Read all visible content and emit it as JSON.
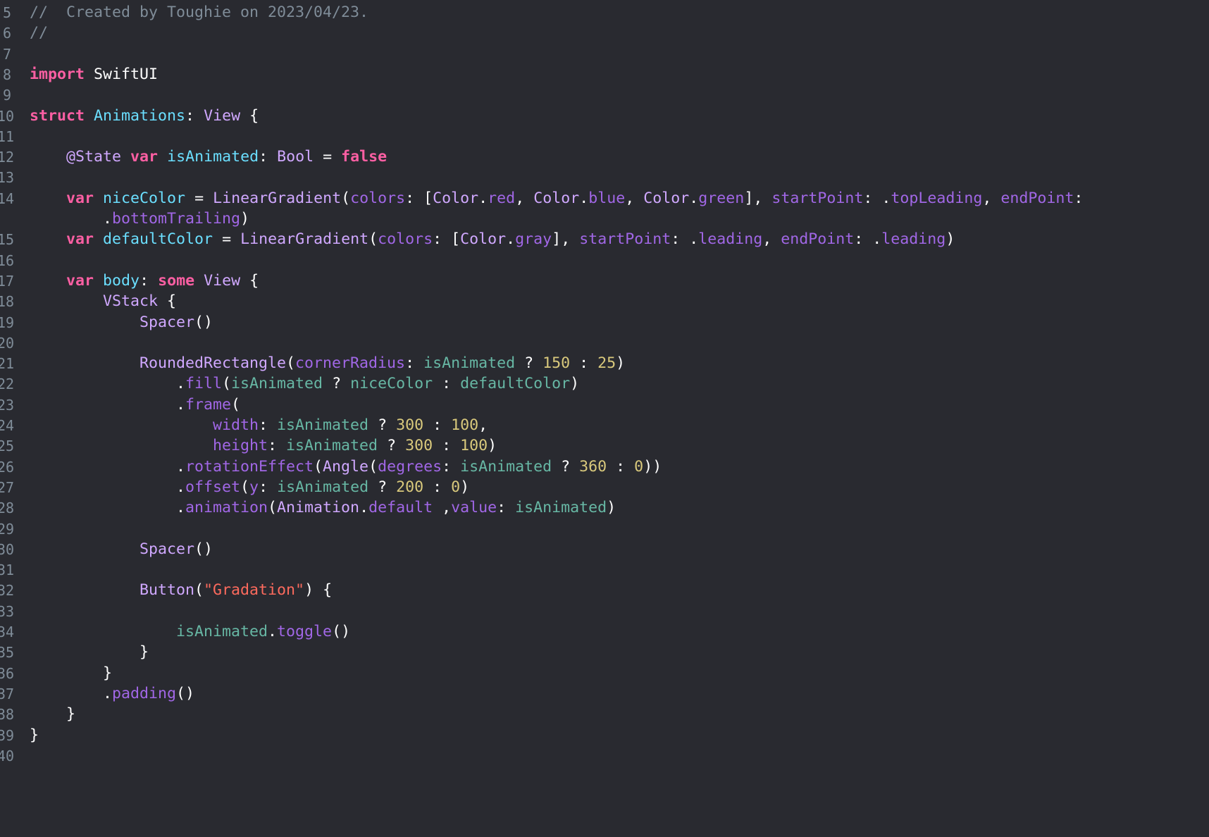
{
  "editor": {
    "theme_background": "#292a30",
    "line_numbers": [
      "5",
      "6",
      "7",
      "8",
      "9",
      "10",
      "11",
      "12",
      "13",
      "14",
      "15",
      "16",
      "17",
      "18",
      "19",
      "20",
      "21",
      "22",
      "23",
      "24",
      "25",
      "26",
      "27",
      "28",
      "29",
      "30",
      "31",
      "32",
      "33",
      "34",
      "35",
      "36",
      "37",
      "38",
      "39",
      "40"
    ],
    "lines": [
      {
        "tokens": [
          {
            "c": "comment",
            "t": "//  Created by Toughie on 2023/04/23."
          }
        ]
      },
      {
        "tokens": [
          {
            "c": "comment",
            "t": "//"
          }
        ]
      },
      {
        "tokens": []
      },
      {
        "tokens": [
          {
            "c": "kw",
            "t": "import"
          },
          {
            "c": "t",
            "t": " SwiftUI"
          }
        ]
      },
      {
        "tokens": []
      },
      {
        "tokens": [
          {
            "c": "kw",
            "t": "struct"
          },
          {
            "c": "t",
            "t": " "
          },
          {
            "c": "decl",
            "t": "Animations"
          },
          {
            "c": "t",
            "t": ": "
          },
          {
            "c": "type",
            "t": "View"
          },
          {
            "c": "t",
            "t": " {"
          }
        ]
      },
      {
        "tokens": []
      },
      {
        "tokens": [
          {
            "c": "t",
            "t": "    "
          },
          {
            "c": "attr",
            "t": "@State"
          },
          {
            "c": "t",
            "t": " "
          },
          {
            "c": "kw",
            "t": "var"
          },
          {
            "c": "t",
            "t": " "
          },
          {
            "c": "decl",
            "t": "isAnimated"
          },
          {
            "c": "t",
            "t": ": "
          },
          {
            "c": "type",
            "t": "Bool"
          },
          {
            "c": "t",
            "t": " = "
          },
          {
            "c": "kw",
            "t": "false"
          }
        ]
      },
      {
        "tokens": []
      },
      {
        "tokens": [
          {
            "c": "t",
            "t": "    "
          },
          {
            "c": "kw",
            "t": "var"
          },
          {
            "c": "t",
            "t": " "
          },
          {
            "c": "decl",
            "t": "niceColor"
          },
          {
            "c": "t",
            "t": " = "
          },
          {
            "c": "type",
            "t": "LinearGradient"
          },
          {
            "c": "t",
            "t": "("
          },
          {
            "c": "param",
            "t": "colors"
          },
          {
            "c": "t",
            "t": ": ["
          },
          {
            "c": "type",
            "t": "Color"
          },
          {
            "c": "t",
            "t": "."
          },
          {
            "c": "mem",
            "t": "red"
          },
          {
            "c": "t",
            "t": ", "
          },
          {
            "c": "type",
            "t": "Color"
          },
          {
            "c": "t",
            "t": "."
          },
          {
            "c": "mem",
            "t": "blue"
          },
          {
            "c": "t",
            "t": ", "
          },
          {
            "c": "type",
            "t": "Color"
          },
          {
            "c": "t",
            "t": "."
          },
          {
            "c": "mem",
            "t": "green"
          },
          {
            "c": "t",
            "t": "], "
          },
          {
            "c": "param",
            "t": "startPoint"
          },
          {
            "c": "t",
            "t": ": ."
          },
          {
            "c": "mem",
            "t": "topLeading"
          },
          {
            "c": "t",
            "t": ", "
          },
          {
            "c": "param",
            "t": "endPoint"
          },
          {
            "c": "t",
            "t": ":"
          }
        ]
      },
      {
        "tokens": [
          {
            "c": "t",
            "t": "        ."
          },
          {
            "c": "mem",
            "t": "bottomTrailing"
          },
          {
            "c": "t",
            "t": ")"
          }
        ],
        "continuation": true
      },
      {
        "tokens": [
          {
            "c": "t",
            "t": "    "
          },
          {
            "c": "kw",
            "t": "var"
          },
          {
            "c": "t",
            "t": " "
          },
          {
            "c": "decl",
            "t": "defaultColor"
          },
          {
            "c": "t",
            "t": " = "
          },
          {
            "c": "type",
            "t": "LinearGradient"
          },
          {
            "c": "t",
            "t": "("
          },
          {
            "c": "param",
            "t": "colors"
          },
          {
            "c": "t",
            "t": ": ["
          },
          {
            "c": "type",
            "t": "Color"
          },
          {
            "c": "t",
            "t": "."
          },
          {
            "c": "mem",
            "t": "gray"
          },
          {
            "c": "t",
            "t": "], "
          },
          {
            "c": "param",
            "t": "startPoint"
          },
          {
            "c": "t",
            "t": ": ."
          },
          {
            "c": "mem",
            "t": "leading"
          },
          {
            "c": "t",
            "t": ", "
          },
          {
            "c": "param",
            "t": "endPoint"
          },
          {
            "c": "t",
            "t": ": ."
          },
          {
            "c": "mem",
            "t": "leading"
          },
          {
            "c": "t",
            "t": ")"
          }
        ]
      },
      {
        "tokens": []
      },
      {
        "tokens": [
          {
            "c": "t",
            "t": "    "
          },
          {
            "c": "kw",
            "t": "var"
          },
          {
            "c": "t",
            "t": " "
          },
          {
            "c": "decl",
            "t": "body"
          },
          {
            "c": "t",
            "t": ": "
          },
          {
            "c": "kw",
            "t": "some"
          },
          {
            "c": "t",
            "t": " "
          },
          {
            "c": "type",
            "t": "View"
          },
          {
            "c": "t",
            "t": " {"
          }
        ]
      },
      {
        "tokens": [
          {
            "c": "t",
            "t": "        "
          },
          {
            "c": "type",
            "t": "VStack"
          },
          {
            "c": "t",
            "t": " {"
          }
        ]
      },
      {
        "tokens": [
          {
            "c": "t",
            "t": "            "
          },
          {
            "c": "type",
            "t": "Spacer"
          },
          {
            "c": "t",
            "t": "()"
          }
        ]
      },
      {
        "tokens": []
      },
      {
        "tokens": [
          {
            "c": "t",
            "t": "            "
          },
          {
            "c": "type",
            "t": "RoundedRectangle"
          },
          {
            "c": "t",
            "t": "("
          },
          {
            "c": "param",
            "t": "cornerRadius"
          },
          {
            "c": "t",
            "t": ": "
          },
          {
            "c": "prop",
            "t": "isAnimated"
          },
          {
            "c": "t",
            "t": " ? "
          },
          {
            "c": "num",
            "t": "150"
          },
          {
            "c": "t",
            "t": " : "
          },
          {
            "c": "num",
            "t": "25"
          },
          {
            "c": "t",
            "t": ")"
          }
        ]
      },
      {
        "tokens": [
          {
            "c": "t",
            "t": "                ."
          },
          {
            "c": "fn",
            "t": "fill"
          },
          {
            "c": "t",
            "t": "("
          },
          {
            "c": "prop",
            "t": "isAnimated"
          },
          {
            "c": "t",
            "t": " ? "
          },
          {
            "c": "prop",
            "t": "niceColor"
          },
          {
            "c": "t",
            "t": " : "
          },
          {
            "c": "prop",
            "t": "defaultColor"
          },
          {
            "c": "t",
            "t": ")"
          }
        ]
      },
      {
        "tokens": [
          {
            "c": "t",
            "t": "                ."
          },
          {
            "c": "fn",
            "t": "frame"
          },
          {
            "c": "t",
            "t": "("
          }
        ]
      },
      {
        "tokens": [
          {
            "c": "t",
            "t": "                    "
          },
          {
            "c": "param",
            "t": "width"
          },
          {
            "c": "t",
            "t": ": "
          },
          {
            "c": "prop",
            "t": "isAnimated"
          },
          {
            "c": "t",
            "t": " ? "
          },
          {
            "c": "num",
            "t": "300"
          },
          {
            "c": "t",
            "t": " : "
          },
          {
            "c": "num",
            "t": "100"
          },
          {
            "c": "t",
            "t": ","
          }
        ]
      },
      {
        "tokens": [
          {
            "c": "t",
            "t": "                    "
          },
          {
            "c": "param",
            "t": "height"
          },
          {
            "c": "t",
            "t": ": "
          },
          {
            "c": "prop",
            "t": "isAnimated"
          },
          {
            "c": "t",
            "t": " ? "
          },
          {
            "c": "num",
            "t": "300"
          },
          {
            "c": "t",
            "t": " : "
          },
          {
            "c": "num",
            "t": "100"
          },
          {
            "c": "t",
            "t": ")"
          }
        ]
      },
      {
        "tokens": [
          {
            "c": "t",
            "t": "                ."
          },
          {
            "c": "fn",
            "t": "rotationEffect"
          },
          {
            "c": "t",
            "t": "("
          },
          {
            "c": "type",
            "t": "Angle"
          },
          {
            "c": "t",
            "t": "("
          },
          {
            "c": "param",
            "t": "degrees"
          },
          {
            "c": "t",
            "t": ": "
          },
          {
            "c": "prop",
            "t": "isAnimated"
          },
          {
            "c": "t",
            "t": " ? "
          },
          {
            "c": "num",
            "t": "360"
          },
          {
            "c": "t",
            "t": " : "
          },
          {
            "c": "num",
            "t": "0"
          },
          {
            "c": "t",
            "t": "))"
          }
        ]
      },
      {
        "tokens": [
          {
            "c": "t",
            "t": "                ."
          },
          {
            "c": "fn",
            "t": "offset"
          },
          {
            "c": "t",
            "t": "("
          },
          {
            "c": "param",
            "t": "y"
          },
          {
            "c": "t",
            "t": ": "
          },
          {
            "c": "prop",
            "t": "isAnimated"
          },
          {
            "c": "t",
            "t": " ? "
          },
          {
            "c": "num",
            "t": "200"
          },
          {
            "c": "t",
            "t": " : "
          },
          {
            "c": "num",
            "t": "0"
          },
          {
            "c": "t",
            "t": ")"
          }
        ]
      },
      {
        "tokens": [
          {
            "c": "t",
            "t": "                ."
          },
          {
            "c": "fn",
            "t": "animation"
          },
          {
            "c": "t",
            "t": "("
          },
          {
            "c": "type",
            "t": "Animation"
          },
          {
            "c": "t",
            "t": "."
          },
          {
            "c": "mem",
            "t": "default"
          },
          {
            "c": "t",
            "t": " ,"
          },
          {
            "c": "param",
            "t": "value"
          },
          {
            "c": "t",
            "t": ": "
          },
          {
            "c": "prop",
            "t": "isAnimated"
          },
          {
            "c": "t",
            "t": ")"
          }
        ]
      },
      {
        "tokens": []
      },
      {
        "tokens": [
          {
            "c": "t",
            "t": "            "
          },
          {
            "c": "type",
            "t": "Spacer"
          },
          {
            "c": "t",
            "t": "()"
          }
        ]
      },
      {
        "tokens": []
      },
      {
        "tokens": [
          {
            "c": "t",
            "t": "            "
          },
          {
            "c": "type",
            "t": "Button"
          },
          {
            "c": "t",
            "t": "("
          },
          {
            "c": "str",
            "t": "\"Gradation\""
          },
          {
            "c": "t",
            "t": ") {"
          }
        ]
      },
      {
        "tokens": []
      },
      {
        "tokens": [
          {
            "c": "t",
            "t": "                "
          },
          {
            "c": "prop",
            "t": "isAnimated"
          },
          {
            "c": "t",
            "t": "."
          },
          {
            "c": "fn",
            "t": "toggle"
          },
          {
            "c": "t",
            "t": "()"
          }
        ]
      },
      {
        "tokens": [
          {
            "c": "t",
            "t": "            }"
          }
        ]
      },
      {
        "tokens": [
          {
            "c": "t",
            "t": "        }"
          }
        ]
      },
      {
        "tokens": [
          {
            "c": "t",
            "t": "        ."
          },
          {
            "c": "fn",
            "t": "padding"
          },
          {
            "c": "t",
            "t": "()"
          }
        ]
      },
      {
        "tokens": [
          {
            "c": "t",
            "t": "    }"
          }
        ]
      },
      {
        "tokens": [
          {
            "c": "t",
            "t": "}"
          }
        ]
      },
      {
        "tokens": []
      }
    ]
  }
}
